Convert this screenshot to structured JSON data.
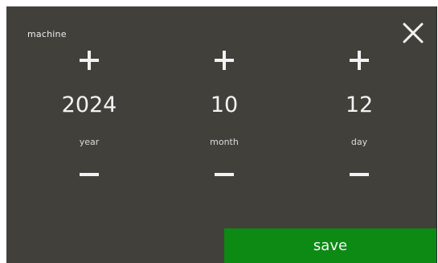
{
  "header": {
    "label": "machine",
    "close_icon": "close-icon"
  },
  "date": {
    "year": {
      "value": "2024",
      "label": "year"
    },
    "month": {
      "value": "10",
      "label": "month"
    },
    "day": {
      "value": "12",
      "label": "day"
    }
  },
  "icons": {
    "increment": "plus-icon",
    "decrement": "minus-icon"
  },
  "footer": {
    "save_label": "save"
  },
  "colors": {
    "panel_bg": "#42403b",
    "text": "#f3f3f3",
    "save_bg": "#0c8a14"
  }
}
